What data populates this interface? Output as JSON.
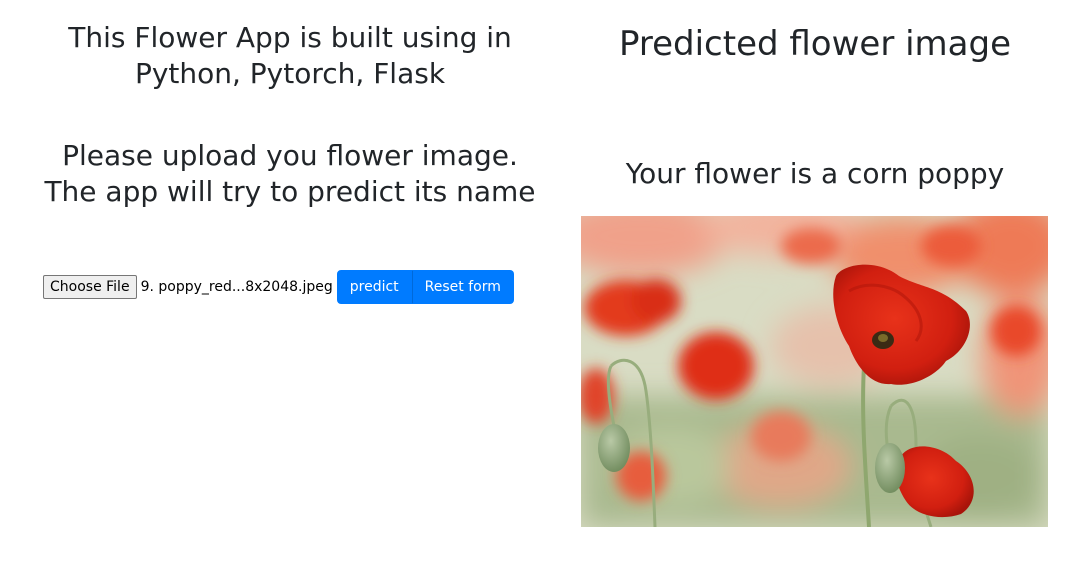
{
  "left": {
    "intro_heading": "This Flower App is built using in Python, Pytorch, Flask",
    "instructions_heading": "Please upload you flower image. The app will try to predict its name",
    "form": {
      "choose_file_label": "Choose File",
      "selected_file_name": "9. poppy_red...8x2048.jpeg",
      "predict_label": "predict",
      "reset_label": "Reset form"
    }
  },
  "right": {
    "result_title": "Predicted flower image",
    "prediction_text": "Your flower is a corn poppy"
  },
  "colors": {
    "button_primary": "#007bff",
    "text": "#212529"
  }
}
